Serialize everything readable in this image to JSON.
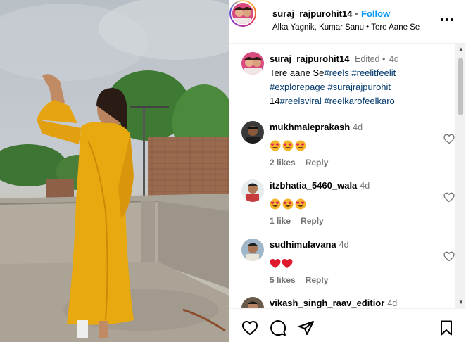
{
  "post": {
    "username": "suraj_rajpurohit14",
    "dot": "•",
    "follow_label": "Follow",
    "audio": "Alka Yagnik, Kumar Sanu • Tere Aane Se",
    "more_icon": "more-horizontal-icon"
  },
  "caption": {
    "username": "suraj_rajpurohit14",
    "edited": "Edited •",
    "time": "4d",
    "text_prefix": "Tere aane Se",
    "tags": [
      "#reels",
      "#reelitfeelit",
      "#explorepage",
      "#surajrajpurohit",
      "#reelsviral",
      "#reelkarofeelkaro"
    ],
    "text_mid": "14"
  },
  "comments": [
    {
      "username": "mukhmaleprakash",
      "time": "4d",
      "reaction": "heart-eyes x3",
      "likes": "2 likes",
      "reply": "Reply"
    },
    {
      "username": "itzbhatia_5460_wala",
      "time": "4d",
      "reaction": "heart-eyes x3",
      "likes": "1 like",
      "reply": "Reply"
    },
    {
      "username": "sudhimulavana",
      "time": "4d",
      "reaction": "red-heart x2",
      "likes": "5 likes",
      "reply": "Reply"
    },
    {
      "username": "vikash_singh_raav_editior",
      "time": "4d"
    }
  ],
  "footer": {
    "icons": [
      "heart-icon",
      "comment-icon",
      "share-icon",
      "bookmark-icon"
    ]
  },
  "colors": {
    "accent": "#0095f6",
    "hashtag": "#00376b",
    "muted": "#737373",
    "dress": "#e8a80f"
  }
}
